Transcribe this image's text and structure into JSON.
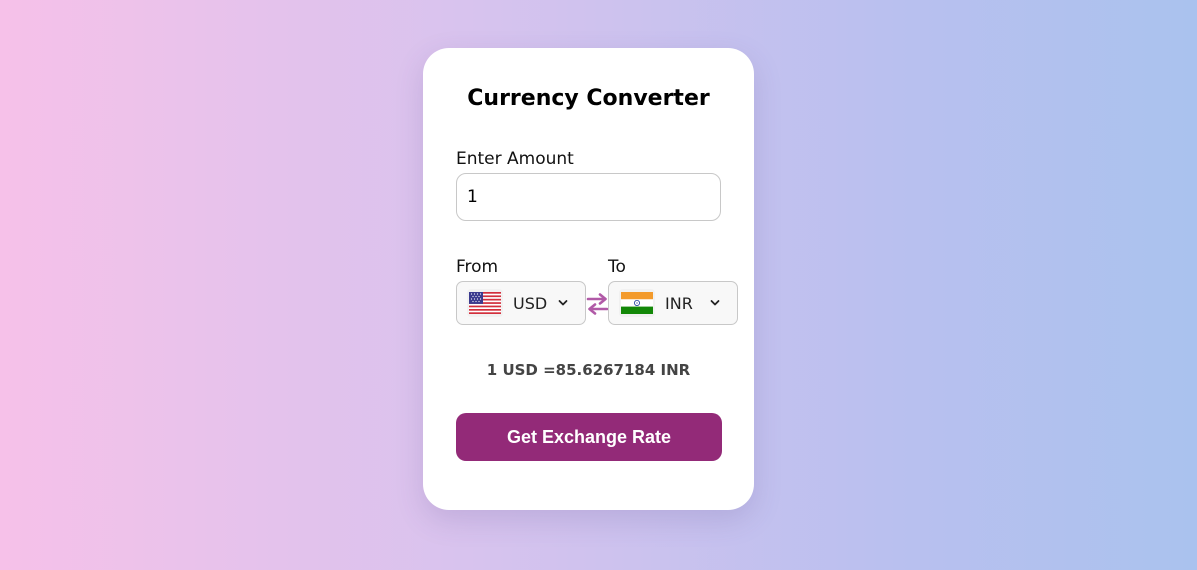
{
  "card": {
    "title": "Currency Converter"
  },
  "amount": {
    "label": "Enter Amount",
    "value": "1"
  },
  "from": {
    "label": "From",
    "currency": "USD",
    "flag_icon": "us-flag-icon"
  },
  "to": {
    "label": "To",
    "currency": "INR",
    "flag_icon": "india-flag-icon"
  },
  "swap_icon": "swap-arrows-icon",
  "result_text": "1 USD =85.6267184 INR",
  "button": {
    "label": "Get Exchange Rate"
  },
  "colors": {
    "accent": "#932a78",
    "swap_icon": "#b15aa7"
  }
}
